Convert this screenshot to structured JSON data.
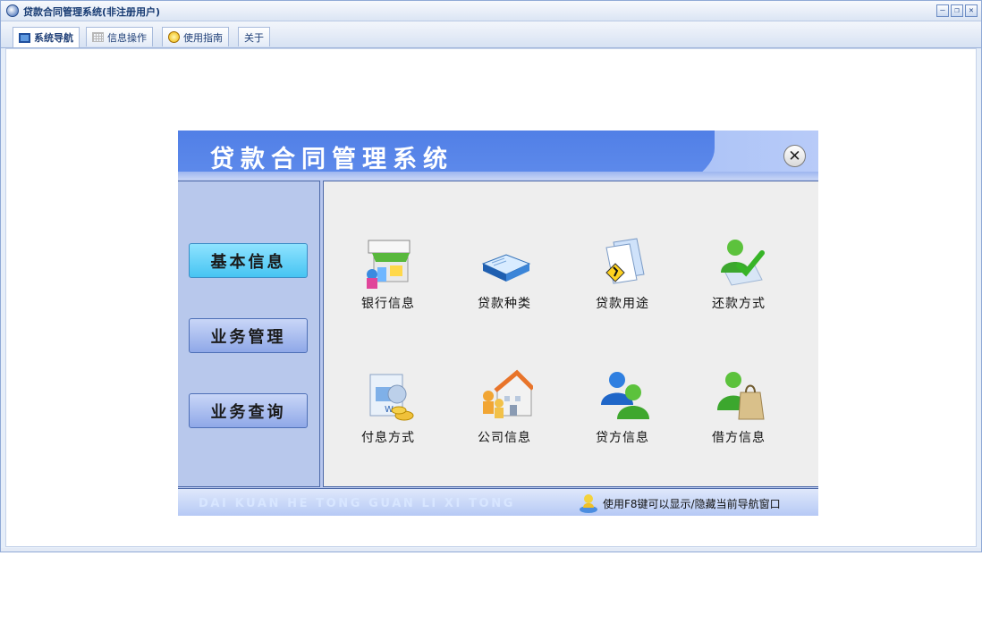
{
  "window": {
    "title": "贷款合同管理系统(非注册用户)",
    "controls": [
      "minimize",
      "restore",
      "close"
    ]
  },
  "tabs": [
    {
      "label": "系统导航",
      "icon": "monitor-icon",
      "active": true
    },
    {
      "label": "信息操作",
      "icon": "grid-icon",
      "active": false
    },
    {
      "label": "使用指南",
      "icon": "help-icon",
      "active": false
    },
    {
      "label": "关于",
      "icon": "",
      "active": false
    }
  ],
  "panel": {
    "title": "贷款合同管理系统",
    "close_glyph": "✕",
    "sidebar": [
      {
        "label": "基本信息",
        "active": true
      },
      {
        "label": "业务管理",
        "active": false
      },
      {
        "label": "业务查询",
        "active": false
      }
    ],
    "items": [
      {
        "label": "银行信息",
        "icon": "bank-store-icon"
      },
      {
        "label": "贷款种类",
        "icon": "book-icon"
      },
      {
        "label": "贷款用途",
        "icon": "folder-document-icon"
      },
      {
        "label": "还款方式",
        "icon": "user-check-icon"
      },
      {
        "label": "付息方式",
        "icon": "money-document-icon"
      },
      {
        "label": "公司信息",
        "icon": "company-building-icon"
      },
      {
        "label": "贷方信息",
        "icon": "lender-users-icon"
      },
      {
        "label": "借方信息",
        "icon": "borrower-bag-icon"
      }
    ],
    "footer": {
      "pinyin": "DAI KUAN HE TONG GUAN LI XI TONG",
      "tip": "使用F8键可以显示/隐藏当前导航窗口"
    }
  },
  "colors": {
    "header_blue": "#4f7fe8",
    "sidebar_bg": "#b8c8ec",
    "active_button": "#46c4f2",
    "content_bg": "#eeeeee"
  }
}
